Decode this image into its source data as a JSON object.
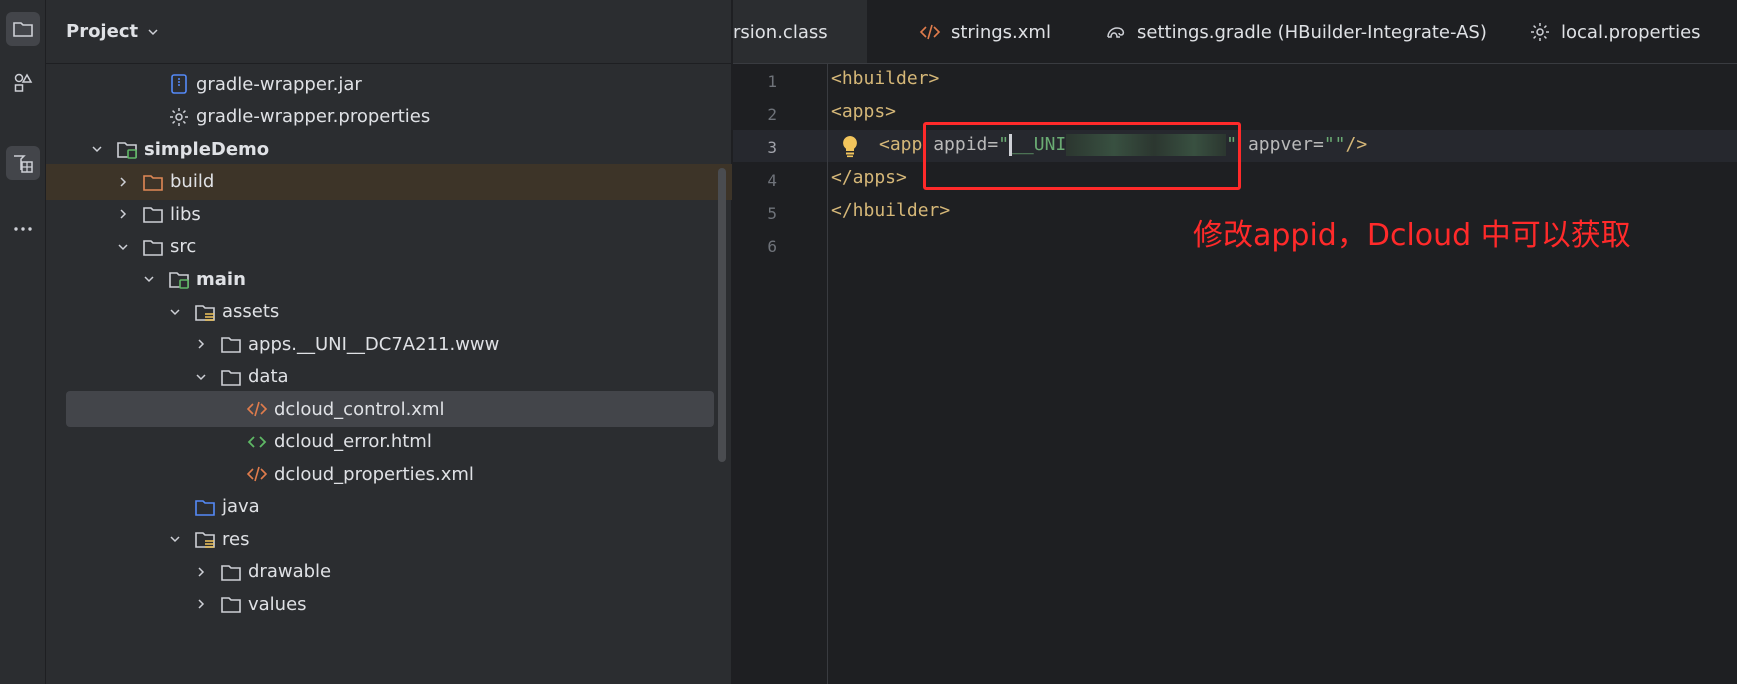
{
  "project": {
    "title": "Project",
    "tree": [
      {
        "label": "gradle-wrapper.jar",
        "icon": "jar-icon",
        "depth": 4,
        "arrow": "none"
      },
      {
        "label": "gradle-wrapper.properties",
        "icon": "gear-icon",
        "depth": 4,
        "arrow": "none"
      },
      {
        "label": "simpleDemo",
        "icon": "module-folder-icon",
        "depth": 2,
        "arrow": "down",
        "bold": true
      },
      {
        "label": "build",
        "icon": "folder-orange-icon",
        "depth": 3,
        "arrow": "right",
        "highlight": true
      },
      {
        "label": "libs",
        "icon": "folder-icon",
        "depth": 3,
        "arrow": "right"
      },
      {
        "label": "src",
        "icon": "folder-icon",
        "depth": 3,
        "arrow": "down"
      },
      {
        "label": "main",
        "icon": "module-folder-icon",
        "depth": 4,
        "arrow": "down",
        "bold": true
      },
      {
        "label": "assets",
        "icon": "resource-folder-icon",
        "depth": 5,
        "arrow": "down"
      },
      {
        "label": "apps.__UNI__DC7A211.www",
        "icon": "folder-icon",
        "depth": 6,
        "arrow": "right"
      },
      {
        "label": "data",
        "icon": "folder-icon",
        "depth": 6,
        "arrow": "down"
      },
      {
        "label": "dcloud_control.xml",
        "icon": "xml-icon",
        "depth": 7,
        "arrow": "none",
        "selected": true
      },
      {
        "label": "dcloud_error.html",
        "icon": "html-icon",
        "depth": 7,
        "arrow": "none"
      },
      {
        "label": "dcloud_properties.xml",
        "icon": "xml-icon",
        "depth": 7,
        "arrow": "none"
      },
      {
        "label": "java",
        "icon": "source-folder-icon",
        "depth": 5,
        "arrow": "none"
      },
      {
        "label": "res",
        "icon": "resource-folder-icon",
        "depth": 5,
        "arrow": "down"
      },
      {
        "label": "drawable",
        "icon": "folder-icon",
        "depth": 6,
        "arrow": "right"
      },
      {
        "label": "values",
        "icon": "folder-icon",
        "depth": 6,
        "arrow": "right"
      }
    ]
  },
  "tabs": [
    {
      "label": "rsion.class",
      "icon": "",
      "active": true
    },
    {
      "label": "strings.xml",
      "icon": "xml-icon"
    },
    {
      "label": "settings.gradle (HBuilder-Integrate-AS)",
      "icon": "gradle-icon"
    },
    {
      "label": "local.properties",
      "icon": "gear-icon"
    }
  ],
  "editor": {
    "line_numbers": [
      "1",
      "2",
      "3",
      "4",
      "5",
      "6"
    ],
    "current_line": "3",
    "lines": {
      "l1": "<hbuilder>",
      "l2": "<apps>",
      "l3_tag": "<app",
      "l3_attr1": "appid",
      "l3_eq1": "=",
      "l3_q_open": "\"",
      "l3_val": "__UNI",
      "l3_q_close": "\"",
      "l3_attr2": "appver",
      "l3_eq2": "=",
      "l3_val2": "\"\"",
      "l3_end": "/>",
      "l4": "</apps>",
      "l5": "</hbuilder>"
    },
    "annotation": "修改appid，Dcloud 中可以获取"
  },
  "colors": {
    "accent_red": "#ff2a2a",
    "xml_tag": "#d5b778",
    "string": "#6aab73"
  }
}
